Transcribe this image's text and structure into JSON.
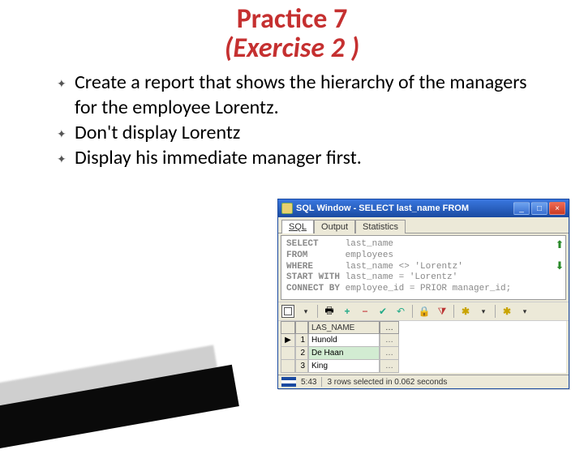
{
  "title": {
    "line1": "Practice 7",
    "line2": "(Exercise 2 )"
  },
  "bullets": [
    "Create a report that shows the hierarchy of the managers for the employee Lorentz.",
    "Don't display Lorentz",
    " Display his immediate manager first."
  ],
  "sql_window": {
    "title": "SQL Window - SELECT last_name FROM",
    "win_buttons": {
      "min": "_",
      "max": "□",
      "close": "×"
    },
    "tabs": [
      "SQL",
      "Output",
      "Statistics"
    ],
    "active_tab": "SQL",
    "code_lines": [
      {
        "kw": "SELECT",
        "rest": "     last_name"
      },
      {
        "kw": "FROM",
        "rest": "       employees"
      },
      {
        "kw": "WHERE",
        "rest": "      last_name <> 'Lorentz'"
      },
      {
        "kw": "START WITH",
        "rest": " last_name = 'Lorentz'"
      },
      {
        "kw": "CONNECT BY",
        "rest": " employee_id = PRIOR manager_id;"
      }
    ],
    "arrow_up": "⬆",
    "arrow_down": "⬇",
    "toolbar_icons": [
      "grid",
      "drop",
      "sep",
      "print",
      "plus",
      "minus",
      "check",
      "undo",
      "sep",
      "lock",
      "filter",
      "sep",
      "query",
      "drop",
      "sep",
      "query",
      "drop"
    ],
    "result": {
      "header": "LAS_NAME",
      "rows": [
        {
          "n": "1",
          "name": "Hunold",
          "selected": false
        },
        {
          "n": "2",
          "name": "De Haan",
          "selected": true
        },
        {
          "n": "3",
          "name": "King",
          "selected": false
        }
      ],
      "dots": "…"
    },
    "status": {
      "time": "5:43",
      "msg": "3 rows selected in 0.062 seconds"
    }
  }
}
